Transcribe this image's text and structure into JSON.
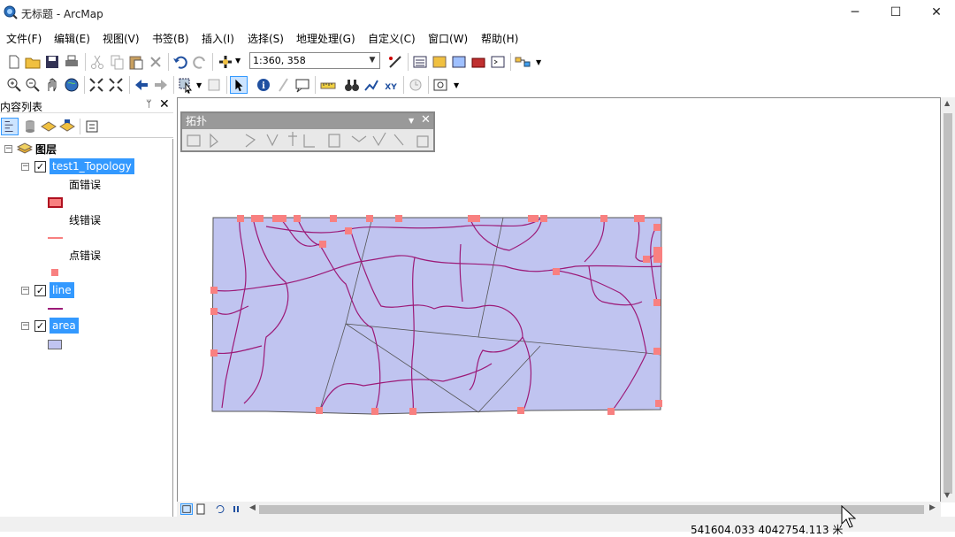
{
  "window": {
    "title": "无标题 - ArcMap",
    "minimize": "─",
    "maximize": "☐",
    "close": "✕"
  },
  "menus": [
    "文件(F)",
    "编辑(E)",
    "视图(V)",
    "书签(B)",
    "插入(I)",
    "选择(S)",
    "地理处理(G)",
    "自定义(C)",
    "窗口(W)",
    "帮助(H)"
  ],
  "toolbar": {
    "scale": "1:360, 358"
  },
  "toc": {
    "title": "内容列表",
    "pin": "ᛘ",
    "close": "✕",
    "root": "图层",
    "layers": [
      {
        "name": "test1_Topology",
        "checked": "✓",
        "symbols": [
          "面错误",
          "线错误",
          "点错误"
        ]
      },
      {
        "name": "line",
        "checked": "✓"
      },
      {
        "name": "area",
        "checked": "✓"
      }
    ]
  },
  "topology_toolbar": {
    "title": "拓扑"
  },
  "status": {
    "coordinates": "541604.033  4042754.113 米"
  },
  "colors": {
    "area_fill": "#c0c4f0",
    "line": "#9c1a78",
    "topology_edge": "#555555",
    "point_error": "#f88080",
    "selection": "#3399ff"
  }
}
